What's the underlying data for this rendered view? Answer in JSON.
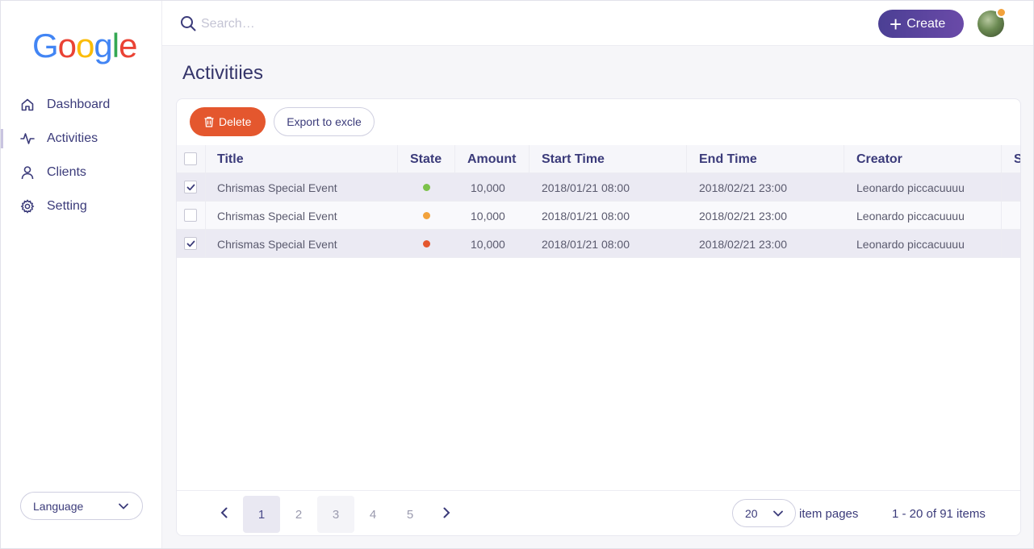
{
  "logo": {
    "letters": [
      "G",
      "o",
      "o",
      "g",
      "l",
      "e"
    ],
    "colors": [
      "#4285f4",
      "#ea4335",
      "#fbbc05",
      "#4285f4",
      "#34a853",
      "#ea4335"
    ]
  },
  "sidebar": {
    "items": [
      {
        "label": "Dashboard",
        "icon": "home-icon"
      },
      {
        "label": "Activities",
        "icon": "activity-icon"
      },
      {
        "label": "Clients",
        "icon": "user-icon"
      },
      {
        "label": "Setting",
        "icon": "gear-icon"
      }
    ],
    "active_index": 1,
    "language_label": "Language"
  },
  "topbar": {
    "search_placeholder": "Search…",
    "create_label": "Create"
  },
  "page": {
    "title": "Activitiies"
  },
  "toolbar": {
    "delete_label": "Delete",
    "export_label": "Export to excle"
  },
  "table": {
    "columns": [
      "Title",
      "State",
      "Amount",
      "Start Time",
      "End Time",
      "Creator",
      "S"
    ],
    "rows": [
      {
        "selected": true,
        "title": "Chrismas Special Event",
        "state_color": "#7cc24a",
        "amount": "10,000",
        "start": "2018/01/21 08:00",
        "end": "2018/02/21 23:00",
        "creator": "Leonardo piccacuuuu"
      },
      {
        "selected": false,
        "title": "Chrismas Special Event",
        "state_color": "#f2a23c",
        "amount": "10,000",
        "start": "2018/01/21 08:00",
        "end": "2018/02/21 23:00",
        "creator": "Leonardo piccacuuuu"
      },
      {
        "selected": true,
        "title": "Chrismas Special Event",
        "state_color": "#e4572e",
        "amount": "10,000",
        "start": "2018/01/21 08:00",
        "end": "2018/02/21 23:00",
        "creator": "Leonardo piccacuuuu"
      }
    ]
  },
  "pagination": {
    "pages": [
      "1",
      "2",
      "3",
      "4",
      "5"
    ],
    "current": "1",
    "per_page": "20",
    "per_page_label": "item pages",
    "range_label": "1 - 20 of 91 items"
  },
  "colors": {
    "accent": "#4b3f94",
    "danger": "#e4572e",
    "text": "#3b3b7a"
  }
}
